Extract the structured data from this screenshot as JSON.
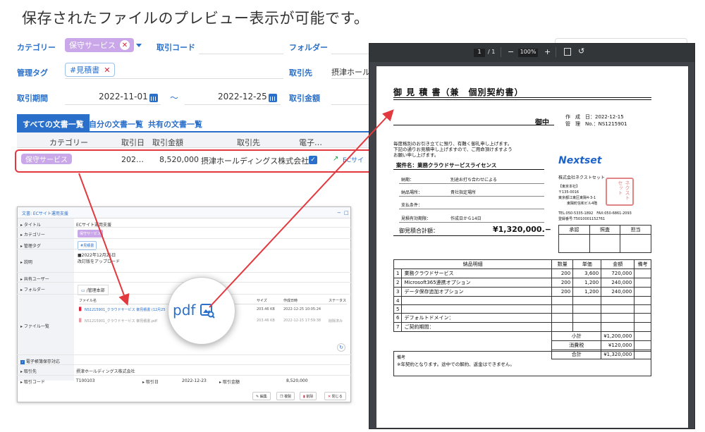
{
  "caption": "保存されたファイルのプレビュー表示が可能です。",
  "search": {
    "category_label": "カテゴリー",
    "category_chip": "保守サービス",
    "trade_code_label": "取引コード",
    "folder_label": "フォルダー",
    "tag_label": "管理タグ",
    "tag_chip": "#見積書",
    "partner_label": "取引先",
    "partner_value": "摂津ホール",
    "period_label": "取引期間",
    "date_from": "2022-11-01",
    "tilde": "〜",
    "date_to": "2022-12-25",
    "amount_label": "取引金額"
  },
  "tabs": [
    "すべての文書一覧",
    "自分の文書一覧",
    "共有の文書一覧"
  ],
  "table": {
    "headers": [
      "カテゴリー",
      "取引日",
      "取引金額",
      "取引先",
      "電子…"
    ],
    "row": {
      "category": "保守サービス",
      "date": "202…",
      "amount": "8,520,000",
      "partner": "摂津ホールディングス株式会社",
      "title": "ECサイ"
    }
  },
  "dialog": {
    "title": "文書: ECサイト運用支援",
    "rows": {
      "title_label": "タイトル",
      "title_value": "ECサイト運用支援",
      "category_label": "カテゴリー",
      "category_value": "保守サービス",
      "tag_label": "管理タグ",
      "tag_value": "#見積書",
      "desc_label": "説明",
      "desc_line1": "■2022年12月25日",
      "desc_line2": "改訂版をアップロード",
      "share_label": "共有ユーザー",
      "folder_label": "フォルダー",
      "folder_value": "/管理本部",
      "files_label": "ファイル一覧",
      "file_col_name": "ファイル名",
      "file_col_size": "サイズ",
      "file_col_date": "作成日時",
      "file_col_status": "ステータス",
      "file1_name": "NS1215901_クラウドサービス 御見積書 (12月25",
      "file1_size": "203.46 KB",
      "file1_date": "2022-12-25 10:05:24",
      "file2_name": "NS1215901_クラウドサービス 御見積書.pdf",
      "file2_size": "203.46 KB",
      "file2_date": "2022-12-15 17:59:38",
      "file2_status": "削除済み",
      "ebook_label": "電子帳簿保存対応",
      "partner_label": "取引先",
      "partner_value": "摂津ホールディングス株式会社",
      "code_label": "取引コード",
      "code_value": "T100103",
      "date_label": "取引日",
      "date_value": "2022-12-23",
      "amount_label": "取引金額",
      "amount_value": "8,520,000"
    },
    "buttons": [
      "編集",
      "複製",
      "削除",
      "閉じる"
    ],
    "magnify_text": "pdf"
  },
  "viewer": {
    "page_current": "1",
    "page_total": "/ 1",
    "zoom": "100%",
    "minus": "−",
    "plus": "+"
  },
  "doc": {
    "title": "御 見 積 書（兼　個別契約書）",
    "to": "御中",
    "date_label": "作　成　日：2022-12-15",
    "no_label": "管　理　No.：NS1215901",
    "intro1": "毎度格別のお引き立てに預り、有難く御礼申し上げます。",
    "intro2": "下記の通りお見積申し上げますので、ご用命頂けますよう",
    "intro3": "お願い申し上げます。",
    "project": "案件名：業務クラウドサービスライセンス",
    "delivery_label": "納期：",
    "delivery_value": "別途お打ち合わせによる",
    "place_label": "納品場所：",
    "place_value": "貴社指定場所",
    "payment_label": "支払条件：",
    "valid_label": "見積有効期限：",
    "valid_value": "作成日から14日",
    "total_label": "御見積合計額：",
    "total_value": "¥1,320,000.−",
    "company_logo": "Nextset",
    "company_name": "株式会社ネクストセット",
    "addr1": "【東京本社】",
    "addr2": "〒135-0016",
    "addr3": "東京都江東区東陽4-3-1",
    "addr4": "東陽町信和ビル4階",
    "tel": "TEL:050-5335-1892　FAX:050-6861-2093",
    "reg": "登録番号:T5010001152761",
    "stamp_boxes": [
      "承認",
      "照査",
      "担当"
    ],
    "items_headers": [
      "納品明細",
      "数量",
      "単価",
      "金額",
      "備考"
    ],
    "items": [
      [
        "1",
        "業務クラウドサービス",
        "200",
        "3,600",
        "720,000"
      ],
      [
        "2",
        "Microsoft365連携オプション",
        "200",
        "1,200",
        "240,000"
      ],
      [
        "3",
        "データ保存追加オプション",
        "200",
        "1,200",
        "240,000"
      ],
      [
        "4",
        "",
        "",
        "",
        ""
      ],
      [
        "5",
        "",
        "",
        "",
        ""
      ],
      [
        "6",
        "デフォルトドメイン：",
        "",
        "",
        ""
      ],
      [
        "7",
        "ご契約期間：",
        "",
        "",
        ""
      ]
    ],
    "subtotal_label": "小計",
    "subtotal": "¥1,200,000",
    "tax_label": "消費税",
    "tax": "¥120,000",
    "grand_label": "合計",
    "grand": "¥1,320,000",
    "note_label": "備考",
    "note_text": "※年契約となります。途中での解約、返金はできません。",
    "seal": "ネクストセット"
  },
  "colors": {
    "accent": "#2a6fc9",
    "highlight": "#e3383e",
    "chip_purple": "#c9a7e8"
  }
}
